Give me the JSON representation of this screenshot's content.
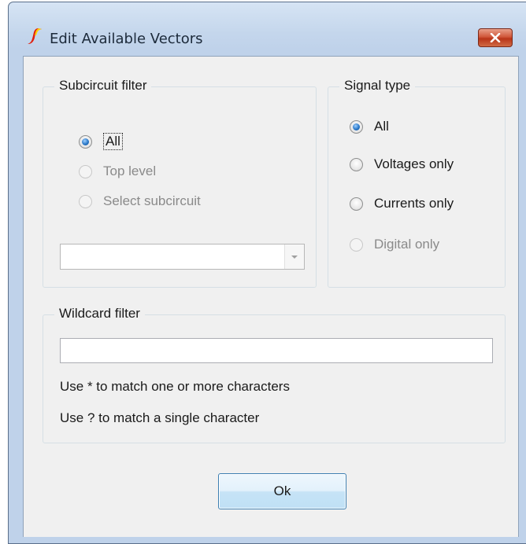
{
  "window": {
    "title": "Edit Available Vectors",
    "close_icon": "close-x-icon",
    "app_icon": "ltspice-logo-icon",
    "accent_close": "#c8492a"
  },
  "subcircuit_filter": {
    "legend": "Subcircuit filter",
    "options": [
      {
        "label": "All",
        "selected": true,
        "enabled": true
      },
      {
        "label": "Top level",
        "selected": false,
        "enabled": false
      },
      {
        "label": "Select subcircuit",
        "selected": false,
        "enabled": false
      }
    ],
    "combo_value": "",
    "combo_icon": "chevron-down-icon"
  },
  "signal_type": {
    "legend": "Signal type",
    "options": [
      {
        "label": "All",
        "selected": true,
        "enabled": true
      },
      {
        "label": "Voltages only",
        "selected": false,
        "enabled": true
      },
      {
        "label": "Currents only",
        "selected": false,
        "enabled": true
      },
      {
        "label": "Digital only",
        "selected": false,
        "enabled": false
      }
    ]
  },
  "wildcard_filter": {
    "legend": "Wildcard filter",
    "value": "",
    "hint_1": "Use * to match one or more characters",
    "hint_2": "Use ? to match a single character"
  },
  "buttons": {
    "ok_label": "Ok"
  }
}
